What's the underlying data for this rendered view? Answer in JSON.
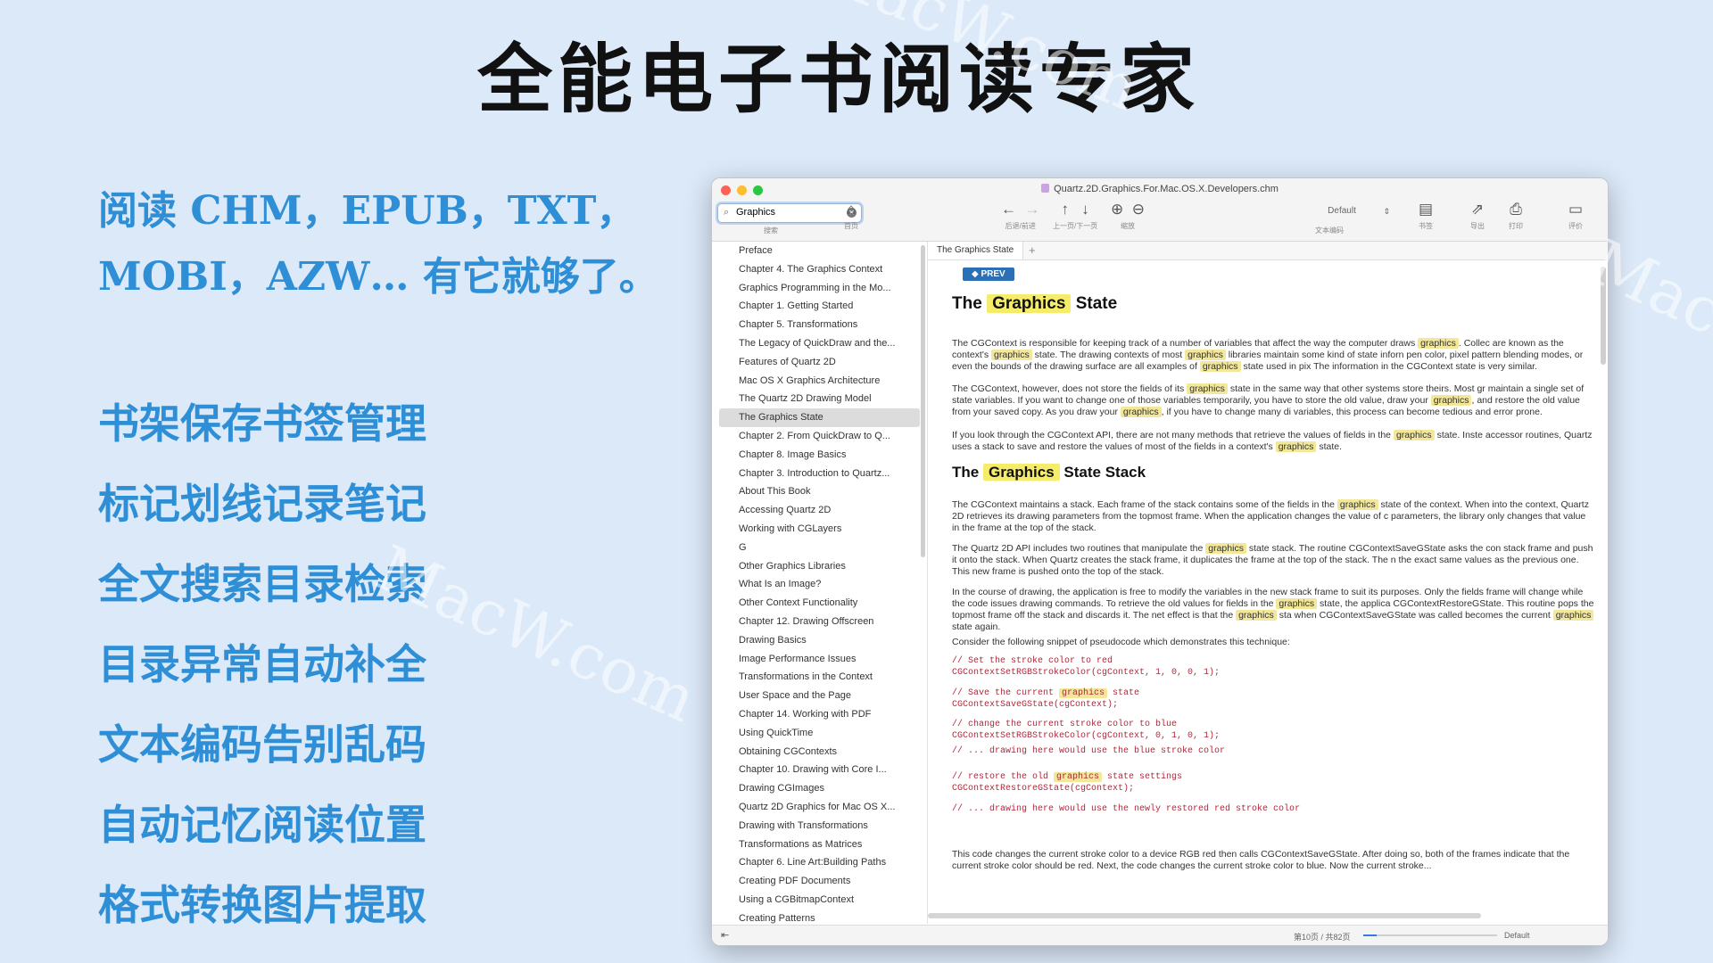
{
  "headline": "全能电子书阅读专家",
  "intro": [
    "阅读 CHM，EPUB，TXT，",
    "MOBI，AZW… 有它就够了。"
  ],
  "features": [
    "书架保存书签管理",
    "标记划线记录笔记",
    "全文搜索目录检索",
    "目录异常自动补全",
    "文本编码告别乱码",
    "自动记忆阅读位置",
    "格式转换图片提取"
  ],
  "watermark": "MacW.com",
  "window": {
    "title": "Quartz.2D.Graphics.For.Mac.OS.X.Developers.chm",
    "search": {
      "value": "Graphics",
      "caption": "搜索"
    },
    "toolbar": {
      "home": "首页",
      "back_forward": "后退/前进",
      "prev_next": "上一页/下一页",
      "zoom": "缩放",
      "encoding": "Default",
      "encoding_caption": "文本编码",
      "bookmark": "书签",
      "export": "导出",
      "print": "打印",
      "review": "评价"
    }
  },
  "toc": {
    "items": [
      "Preface",
      "Chapter 4.  The Graphics Context",
      "Graphics Programming in the Mo...",
      "Chapter 1.  Getting Started",
      "Chapter 5.  Transformations",
      "The Legacy of QuickDraw and the...",
      "Features of Quartz 2D",
      "Mac OS X Graphics Architecture",
      "The Quartz 2D Drawing Model",
      "The Graphics State",
      "Chapter 2.  From QuickDraw to Q...",
      "Chapter 8.  Image Basics",
      "Chapter 3.  Introduction to Quartz...",
      "About This Book",
      "Accessing Quartz 2D",
      "Working with CGLayers",
      "G",
      "Other Graphics Libraries",
      "What Is an Image?",
      "Other Context Functionality",
      "Chapter 12.  Drawing Offscreen",
      "Drawing Basics",
      "Image Performance Issues",
      "Transformations in the Context",
      "User Space and the Page",
      "Chapter 14.  Working with PDF",
      "Using QuickTime",
      "Obtaining CGContexts",
      "Chapter 10.  Drawing with Core I...",
      "Drawing CGImages",
      "Quartz 2D Graphics for Mac OS X...",
      "Drawing with Transformations",
      "Transformations as Matrices",
      "Chapter 6.  Line Art:Building Paths",
      "Creating PDF Documents",
      "Using a CGBitmapContext",
      "Creating Patterns"
    ],
    "selected_index": 9
  },
  "tab": {
    "label": "The Graphics State",
    "add": "+"
  },
  "doc": {
    "prev": "◆ PREV",
    "h1": {
      "pre": "The",
      "hl": "Graphics",
      "post": "State"
    },
    "p1": {
      "a": "The CGContext is responsible for keeping track of a number of variables that affect the way the computer draws",
      "h1": "graphics",
      "b": ". Collec are known as the context's",
      "h2": "graphics",
      "c": "state. The drawing contexts of most",
      "h3": "graphics",
      "d": "libraries maintain some kind of state inforn pen color, pixel pattern blending modes, or even the bounds of the drawing surface are all examples of",
      "h4": "graphics",
      "e": "state used in pix The information in the CGContext state is very similar."
    },
    "p2": {
      "a": "The CGContext, however, does not store the fields of its",
      "h1": "graphics",
      "b": "state in the same way that other systems store theirs. Most gr maintain a single set of state variables. If you want to change one of those variables temporarily, you have to store the old value, draw your",
      "h2": "graphics",
      "c": ", and restore the old value from your saved copy. As you draw your",
      "h3": "graphics",
      "d": ", if you have to change many di variables, this process can become tedious and error prone."
    },
    "p3": {
      "a": "If you look through the CGContext API, there are not many methods that retrieve the values of fields in the",
      "h1": "graphics",
      "b": "state. Inste accessor routines, Quartz uses a stack to save and restore the values of most of the fields in a context's",
      "h2": "graphics",
      "c": "state."
    },
    "h2": {
      "pre": "The",
      "hl": "Graphics",
      "post": "State Stack"
    },
    "p4": {
      "a": "The CGContext maintains a stack. Each frame of the stack contains some of the fields in the",
      "h1": "graphics",
      "b": "state of the context. When into the context, Quartz 2D retrieves its drawing parameters from the topmost frame. When the application changes the value of c parameters, the library only changes that value in the frame at the top of the stack."
    },
    "p5": {
      "a": "The Quartz 2D API includes two routines that manipulate the",
      "h1": "graphics",
      "b": "state stack. The routine CGContextSaveGState asks the con stack frame and push it onto the stack. When Quartz creates the stack frame, it duplicates the frame at the top of the stack. The n the exact same values as the previous one. This new frame is pushed onto the top of the stack."
    },
    "p6": {
      "a": "In the course of drawing, the application is free to modify the variables in the new stack frame to suit its purposes. Only the fields frame will change while the code issues drawing commands. To retrieve the old values for fields in the",
      "h1": "graphics",
      "b": "state, the applica CGContextRestoreGState. This routine pops the topmost frame off the stack and discards it. The net effect is that the",
      "h2": "graphics",
      "c": "sta when CGContextSaveGState was called becomes the current",
      "h3": "graphics",
      "d": "state again."
    },
    "p7": "Consider the following snippet of pseudocode which demonstrates this technique:",
    "code": [
      {
        "c": "// Set the stroke color to red",
        "k": "CGContextSetRGBStrokeColor(cgContext, 1, 0, 0, 1);"
      },
      {
        "c1": "// Save the current ",
        "hl": "graphics",
        "c2": " state",
        "k": "CGContextSaveGState(cgContext);"
      },
      {
        "c": "// change the current stroke color to blue",
        "k": "CGContextSetRGBStrokeColor(cgContext, 0, 1, 0, 1);"
      },
      {
        "c": "// ... drawing here would use the blue stroke color"
      },
      {
        "c1": "// restore the old ",
        "hl": "graphics",
        "c2": " state settings",
        "k": "CGContextRestoreGState(cgContext);"
      },
      {
        "c": "// ... drawing here would use the newly restored red stroke color"
      }
    ],
    "p8": "This code changes the current stroke color to a device RGB red then calls CGContextSaveGState. After doing so, both of the frames indicate that the current stroke color should be red. Next, the code changes the current stroke color to blue. Now the current stroke..."
  },
  "status": {
    "page": "第10页 / 共82页",
    "encoding": "Default",
    "zoom_fraction": 0.1
  }
}
